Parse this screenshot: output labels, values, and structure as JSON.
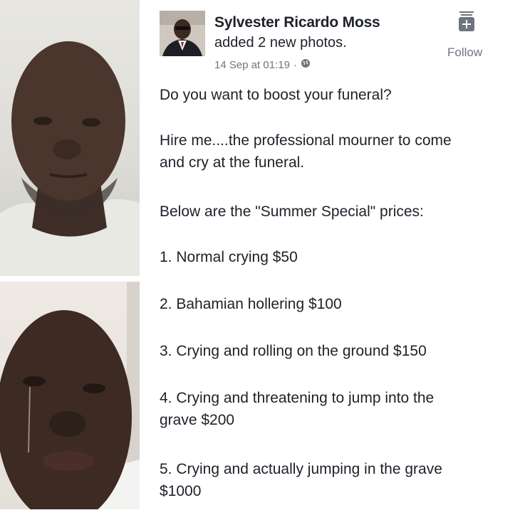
{
  "post": {
    "author": "Sylvester Ricardo Moss",
    "action": "added 2 new photos.",
    "timestamp": "14 Sep at 01:19",
    "separator": "·",
    "privacy_icon": "globe-icon",
    "follow_label": "Follow",
    "follow_icon": "follow-plus-icon"
  },
  "body": {
    "line1": "Do you want to boost your funeral?",
    "line2a": "Hire me....the professional mourner to come",
    "line2b": "and cry at the funeral.",
    "line3": "Below are the \"Summer Special\"  prices:",
    "item1": "1. Normal crying $50",
    "item2": "2. Bahamian hollering $100",
    "item3": "3. Crying and rolling on the ground $150",
    "item4a": "4. Crying and threatening to jump into the",
    "item4b": "grave $200",
    "item5a": "5. Crying and actually jumping in the grave",
    "item5b": "$1000"
  },
  "colors": {
    "text": "#1d2129",
    "meta": "#6e7480"
  }
}
